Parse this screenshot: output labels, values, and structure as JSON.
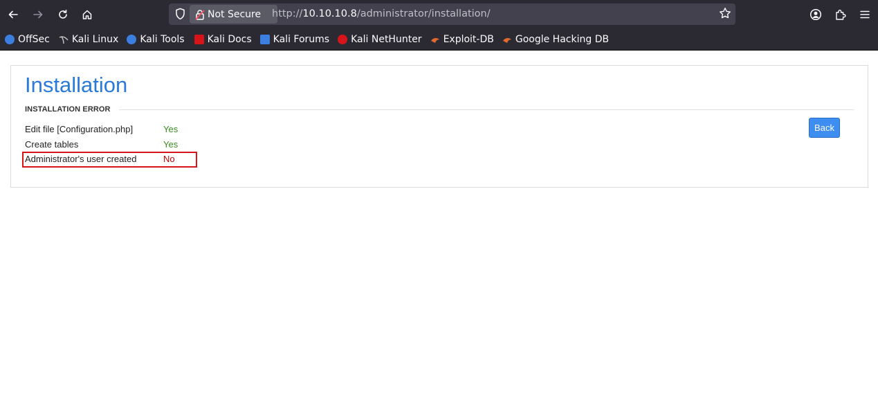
{
  "browser": {
    "security_label": "Not Secure",
    "url_prefix": "http://",
    "url_host": "10.10.10.8",
    "url_path": "/administrator/installation/"
  },
  "bookmarks": [
    {
      "label": "OffSec",
      "icon": "offsec-icon",
      "color": "#3d7fe0"
    },
    {
      "label": "Kali Linux",
      "icon": "kali-dragon-icon",
      "color": "#cccccc"
    },
    {
      "label": "Kali Tools",
      "icon": "kali-tools-icon",
      "color": "#3d7fe0"
    },
    {
      "label": "Kali Docs",
      "icon": "kali-docs-icon",
      "color": "#d7141a"
    },
    {
      "label": "Kali Forums",
      "icon": "kali-forums-icon",
      "color": "#3d7fe0"
    },
    {
      "label": "Kali NetHunter",
      "icon": "kali-nethunter-icon",
      "color": "#d7141a"
    },
    {
      "label": "Exploit-DB",
      "icon": "exploit-db-icon",
      "color": "#e3682b"
    },
    {
      "label": "Google Hacking DB",
      "icon": "ghdb-icon",
      "color": "#e3682b"
    }
  ],
  "page": {
    "title": "Installation",
    "section_label": "INSTALLATION ERROR",
    "back_label": "Back",
    "rows": [
      {
        "label": "Edit file [Configuration.php]",
        "value": "Yes",
        "status": "ok"
      },
      {
        "label": "Create tables",
        "value": "Yes",
        "status": "ok"
      },
      {
        "label": "Administrator's user created",
        "value": "No",
        "status": "error"
      }
    ]
  },
  "colors": {
    "title_blue": "#2a7ad9",
    "yes_green": "#3a8a1f",
    "no_red": "#c00000",
    "highlight_red": "#d7141a",
    "button_blue": "#3d8ef0"
  }
}
